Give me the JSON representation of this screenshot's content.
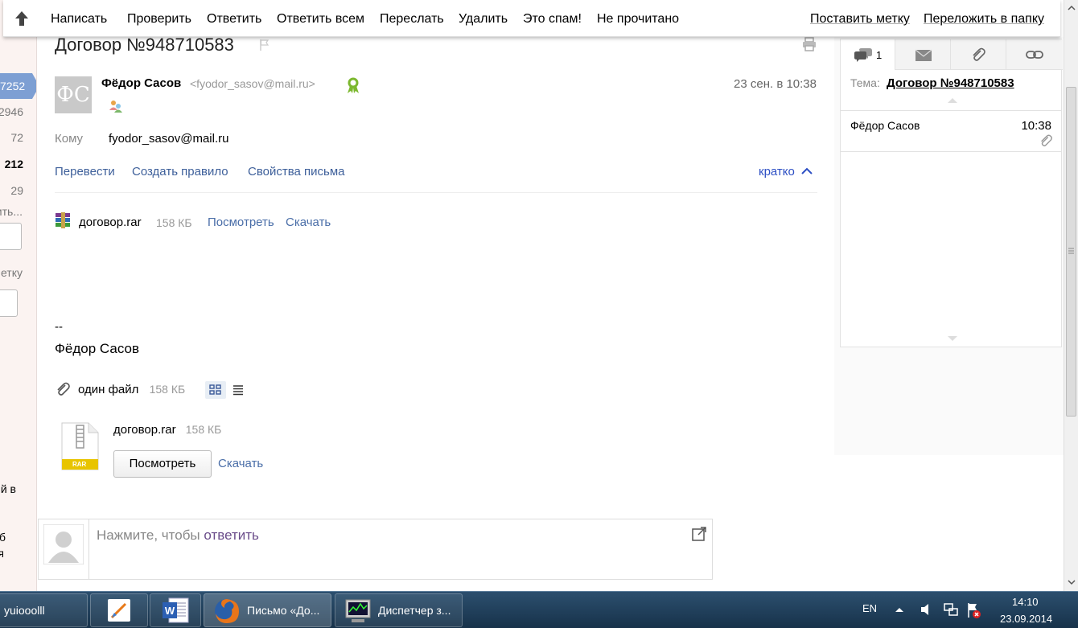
{
  "left_strip": {
    "active_count": "7252",
    "count1": "2946",
    "count2": "72",
    "count3": "212",
    "count4": "29",
    "text1": "ить...",
    "text2": "етку",
    "text3": "й в",
    "text4": "б",
    "text5": "я"
  },
  "toolbar": {
    "compose": "Написать",
    "check": "Проверить",
    "reply": "Ответить",
    "reply_all": "Ответить всем",
    "forward": "Переслать",
    "delete": "Удалить",
    "spam": "Это спам!",
    "unread": "Не прочитано",
    "label": "Поставить метку",
    "move": "Переложить в папку"
  },
  "message": {
    "subject": "Договор №948710583",
    "avatar_initials": "ФС",
    "sender_name": "Фёдор Сасов",
    "sender_email": "<fyodor_sasov@mail.ru>",
    "date": "23 сен. в 10:38",
    "to_label": "Кому",
    "to_value": "fyodor_sasov@mail.ru",
    "translate": "Перевести",
    "create_rule": "Создать правило",
    "properties": "Свойства письма",
    "short_toggle": "кратко",
    "attachment": {
      "name": "договор.rar",
      "size": "158 КБ",
      "view": "Посмотреть",
      "download": "Скачать"
    },
    "signature_dash": "--",
    "signature_name": "Фёдор Сасов",
    "files_summary": "один файл",
    "files_size": "158 КБ",
    "file_card": {
      "name": "договор.rar",
      "size": "158 КБ",
      "view_button": "Посмотреть",
      "download": "Скачать",
      "ext_label": "RAR"
    },
    "reply_prompt": "Нажмите, чтобы",
    "reply_link": "ответить"
  },
  "right_panel": {
    "thread_count": "1",
    "topic_label": "Тема:",
    "topic": "Договор №948710583",
    "item_sender": "Фёдор Сасов",
    "item_time": "10:38"
  },
  "taskbar": {
    "task1": "yuiooolll",
    "task_firefox": "Письмо «До...",
    "task_manager": "Диспетчер з...",
    "lang": "EN",
    "time": "14:10",
    "date": "23.09.2014"
  },
  "colors": {
    "link": "#3d5f9a",
    "accent_blue": "#7d9fd3",
    "taskbar": "#1f3d58"
  }
}
